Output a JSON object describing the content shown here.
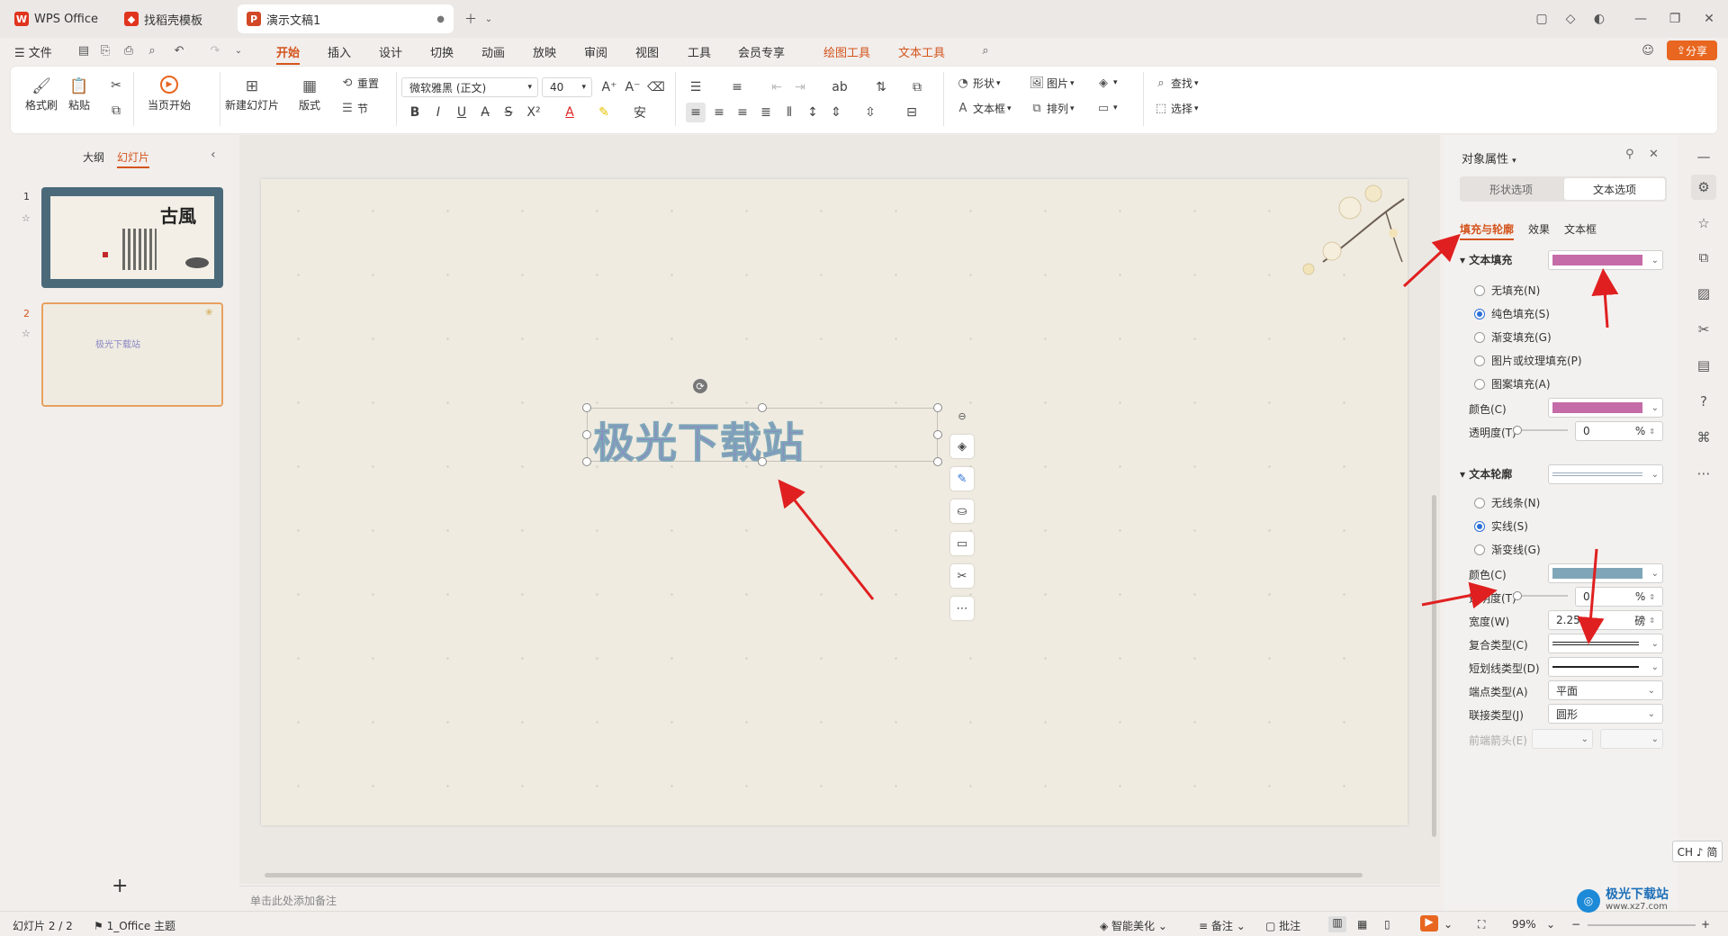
{
  "tabs": {
    "wps": "WPS Office",
    "template": "找稻壳模板",
    "doc": "演示文稿1"
  },
  "menu": {
    "file": "文件",
    "items": [
      "开始",
      "插入",
      "设计",
      "切换",
      "动画",
      "放映",
      "审阅",
      "视图",
      "工具",
      "会员专享"
    ],
    "tools": [
      "绘图工具",
      "文本工具"
    ],
    "share": "分享"
  },
  "ribbon": {
    "format_painter": "格式刷",
    "paste": "粘贴",
    "play_from_current": "当页开始",
    "new_slide": "新建幻灯片",
    "layout": "版式",
    "reset": "重置",
    "section": "节",
    "font_name": "微软雅黑 (正文)",
    "font_size": "40",
    "shape": "形状",
    "picture": "图片",
    "textbox": "文本框",
    "arrange": "排列",
    "find": "查找",
    "select": "选择"
  },
  "leftpanel": {
    "outline_tab": "大纲",
    "slides_tab": "幻灯片",
    "slide1_num": "1",
    "slide2_num": "2",
    "slide1_title": "古風",
    "slide2_text": "极光下载站"
  },
  "slide": {
    "text": "极光下载站"
  },
  "notes": {
    "placeholder": "单击此处添加备注"
  },
  "rpanel": {
    "title": "对象属性",
    "tab_shape": "形状选项",
    "tab_text": "文本选项",
    "subtabs": [
      "填充与轮廓",
      "效果",
      "文本框"
    ],
    "fill_section": "文本填充",
    "fill_color": "#c56ba7",
    "fill_options": [
      "无填充(N)",
      "纯色填充(S)",
      "渐变填充(G)",
      "图片或纹理填充(P)",
      "图案填充(A)"
    ],
    "color_label": "颜色(C)",
    "transparency_label": "透明度(T)",
    "transparency_value": "0",
    "percent": "%",
    "outline_section": "文本轮廓",
    "outline_options": [
      "无线条(N)",
      "实线(S)",
      "渐变线(G)"
    ],
    "outline_color": "#7fa6b8",
    "width_label": "宽度(W)",
    "width_value": "2.25",
    "width_unit": "磅",
    "compound_label": "复合类型(C)",
    "dash_label": "短划线类型(D)",
    "cap_label": "端点类型(A)",
    "cap_value": "平面",
    "join_label": "联接类型(J)",
    "join_value": "圆形",
    "begin_arrow_label": "前端箭头(E)"
  },
  "status": {
    "slide_count": "幻灯片 2 / 2",
    "theme": "1_Office 主题",
    "beautify": "智能美化",
    "notes": "备注",
    "comments": "批注",
    "zoom": "99%",
    "ime": "CH ♪ 简"
  },
  "watermark": {
    "text": "极光下载站",
    "url": "www.xz7.com"
  }
}
